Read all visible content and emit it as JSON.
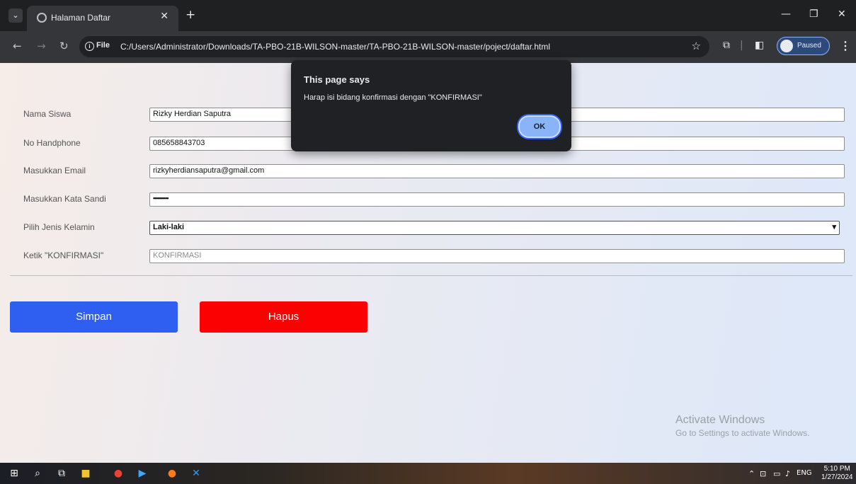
{
  "browser": {
    "tab_title": "Halaman Daftar",
    "file_chip": "File",
    "url": "C:/Users/Administrator/Downloads/TA-PBO-21B-WILSON-master/TA-PBO-21B-WILSON-master/poject/daftar.html",
    "profile_label": "Paused"
  },
  "form": {
    "fields": [
      {
        "label": "Nama Siswa",
        "value": "Rizky Herdian Saputra"
      },
      {
        "label": "No Handphone",
        "value": "085658843703"
      },
      {
        "label": "Masukkan Email",
        "value": "rizkyherdiansaputra@gmail.com"
      },
      {
        "label": "Masukkan Kata Sandi",
        "value": "••••••••••"
      },
      {
        "label": "Pilih Jenis Kelamin",
        "value": "Laki-laki"
      },
      {
        "label": "Ketik \"KONFIRMASI\"",
        "placeholder": "KONFIRMASI"
      }
    ],
    "save_label": "Simpan",
    "delete_label": "Hapus"
  },
  "dialog": {
    "title": "This page says",
    "message": "Harap isi bidang konfirmasi dengan \"KONFIRMASI\"",
    "ok_label": "OK"
  },
  "watermark": {
    "line1": "Activate Windows",
    "line2": "Go to Settings to activate Windows."
  },
  "tray": {
    "lang": "ENG",
    "time": "5:10 PM",
    "date": "1/27/2024"
  },
  "colors": {
    "save_button": "#2f5ff0",
    "delete_button": "#fb0101",
    "dialog_bg": "#202124",
    "ok_button": "#8ab4f8"
  }
}
